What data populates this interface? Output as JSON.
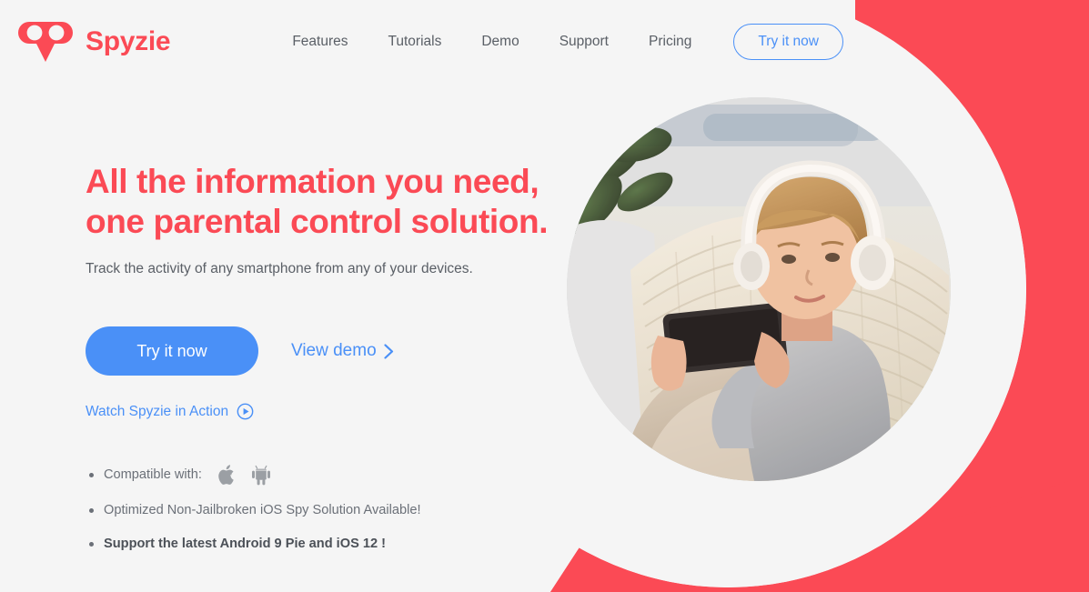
{
  "brand": {
    "name": "Spyzie",
    "logo_icon": "spyzie-owl-eyes-logo",
    "color": "#fb4a55"
  },
  "nav": {
    "items": [
      {
        "label": "Features"
      },
      {
        "label": "Tutorials"
      },
      {
        "label": "Demo"
      },
      {
        "label": "Support"
      },
      {
        "label": "Pricing"
      }
    ],
    "cta": {
      "label": "Try it now",
      "color": "#4a90f7"
    }
  },
  "hero": {
    "title_line1": "All the information you need,",
    "title_line2": "one parental control solution.",
    "subtitle": "Track the activity of any smartphone from any of your devices.",
    "primary_button": "Try it now",
    "demo_link": "View demo",
    "demo_link_icon": "chevron-right-icon",
    "watch_link": "Watch Spyzie in Action",
    "watch_link_icon": "play-circle-icon",
    "features": [
      {
        "text": "Compatible with:",
        "bold": false,
        "icons": [
          "apple-icon",
          "android-icon"
        ]
      },
      {
        "text": "Optimized Non-Jailbroken iOS Spy Solution Available!",
        "bold": false,
        "icons": []
      },
      {
        "text": "Support the latest Android 9 Pie and iOS 12 !",
        "bold": true,
        "icons": []
      }
    ]
  },
  "artwork": {
    "photo_alt": "child-with-headphones-using-smartphone",
    "red_shape_color": "#fb4a55",
    "background_color": "#f5f5f5"
  }
}
